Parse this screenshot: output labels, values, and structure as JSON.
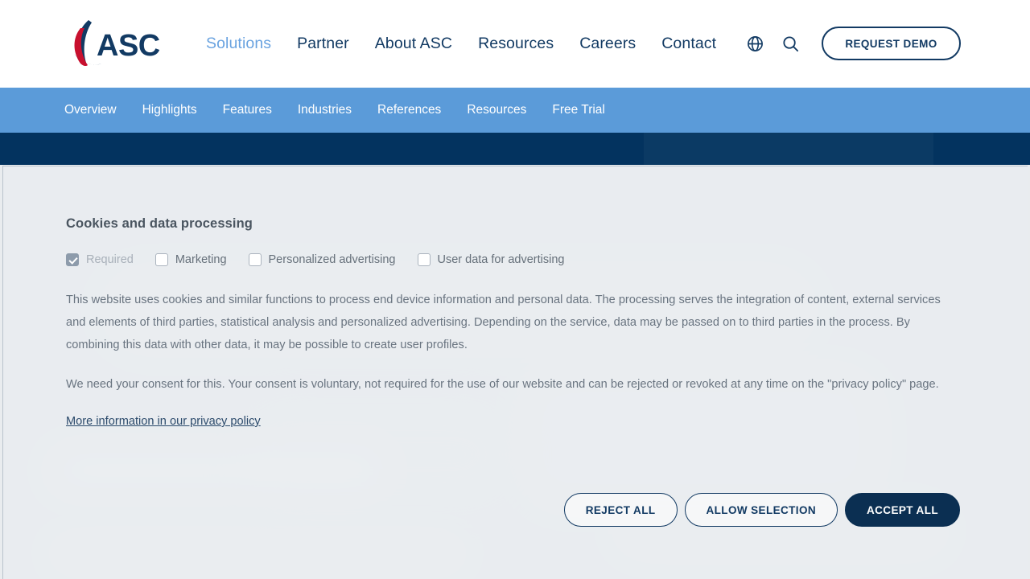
{
  "header": {
    "logo_text": "ASC",
    "logo_name": "asc-logo",
    "nav": [
      {
        "label": "Solutions",
        "active": true
      },
      {
        "label": "Partner",
        "active": false
      },
      {
        "label": "About ASC",
        "active": false
      },
      {
        "label": "Resources",
        "active": false
      },
      {
        "label": "Careers",
        "active": false
      },
      {
        "label": "Contact",
        "active": false
      }
    ],
    "icons": [
      {
        "name": "globe-icon"
      },
      {
        "name": "search-icon"
      }
    ],
    "demo_button": "REQUEST DEMO"
  },
  "subnav": {
    "items": [
      {
        "label": "Overview"
      },
      {
        "label": "Highlights"
      },
      {
        "label": "Features"
      },
      {
        "label": "Industries"
      },
      {
        "label": "References"
      },
      {
        "label": "Resources"
      },
      {
        "label": "Free Trial"
      }
    ]
  },
  "cookie_banner": {
    "title": "Cookies and data processing",
    "options": [
      {
        "label": "Required",
        "checked": true,
        "disabled": true
      },
      {
        "label": "Marketing",
        "checked": false,
        "disabled": false
      },
      {
        "label": "Personalized advertising",
        "checked": false,
        "disabled": false
      },
      {
        "label": "User data for advertising",
        "checked": false,
        "disabled": false
      }
    ],
    "paragraph_1": "This website uses cookies and similar functions to process end device information and personal data. The processing serves the integration of content, external services and elements of third parties, statistical analysis and personalized advertising. Depending on the service, data may be passed on to third parties in the process. By combining this data with other data, it may be possible to create user profiles.",
    "paragraph_2": "We need your consent for this. Your consent is voluntary, not required for the use of our website and can be rejected or revoked at any time on the \"privacy policy\" page.",
    "link": "More information in our privacy policy",
    "buttons": {
      "reject": "REJECT ALL",
      "allow_selection": "ALLOW SELECTION",
      "accept": "ACCEPT ALL"
    }
  },
  "colors": {
    "navy": "#123a63",
    "dark_navy": "#03335f",
    "subnav_blue": "#5b9bd9",
    "active_link_blue": "#6aa3e0",
    "logo_red": "#c8102e",
    "overlay_bg": "#e9ecef"
  }
}
